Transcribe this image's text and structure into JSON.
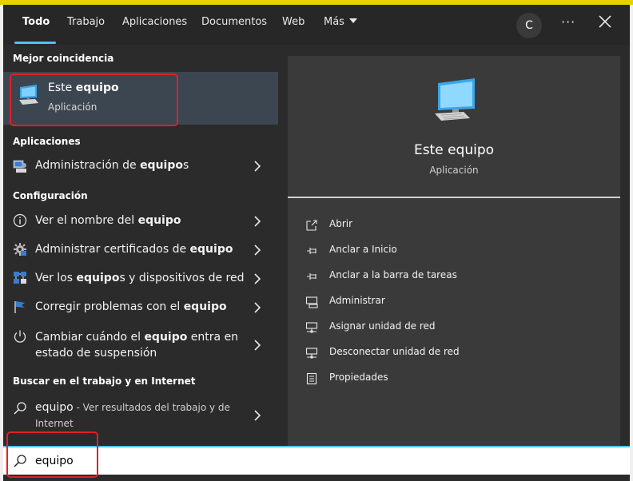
{
  "tabs": {
    "todo": "Todo",
    "trabajo": "Trabajo",
    "aplicaciones": "Aplicaciones",
    "documentos": "Documentos",
    "web": "Web",
    "mas": "Más"
  },
  "header": {
    "avatar_initial": "C",
    "more_glyph": "···"
  },
  "best_match": {
    "heading": "Mejor coincidencia",
    "title_prefix": "Este ",
    "title_bold": "equipo",
    "subtitle": "Aplicación",
    "icon": "computer-icon"
  },
  "sections": {
    "aplicaciones": "Aplicaciones",
    "configuracion": "Configuración",
    "buscar": "Buscar en el trabajo y en Internet"
  },
  "apps": [
    {
      "pre": "Administración de ",
      "bold": "equipo",
      "post": "s",
      "icon": "computer-management-icon"
    }
  ],
  "settings": [
    {
      "pre": "Ver el nombre del ",
      "bold": "equipo",
      "post": "",
      "icon": "info-icon"
    },
    {
      "pre": "Administrar certificados de ",
      "bold": "equipo",
      "post": "",
      "icon": "certificate-icon"
    },
    {
      "pre": "Ver los ",
      "bold": "equipo",
      "post": "s y dispositivos de red",
      "icon": "network-devices-icon"
    },
    {
      "pre": "Corregir problemas con el ",
      "bold": "equipo",
      "post": "",
      "icon": "flag-icon"
    },
    {
      "pre": "Cambiar cuándo el ",
      "bold": "equipo",
      "post": " entra en estado de suspensión",
      "icon": "power-icon"
    }
  ],
  "web_result": {
    "query": "equipo",
    "desc": " - Ver resultados del trabajo y de Internet"
  },
  "preview": {
    "title": "Este equipo",
    "subtitle": "Aplicación"
  },
  "actions": [
    {
      "label": "Abrir",
      "icon": "open-icon"
    },
    {
      "label": "Anclar a Inicio",
      "icon": "pin-icon"
    },
    {
      "label": "Anclar a la barra de tareas",
      "icon": "pin-taskbar-icon"
    },
    {
      "label": "Administrar",
      "icon": "manage-icon"
    },
    {
      "label": "Asignar unidad de red",
      "icon": "map-drive-icon"
    },
    {
      "label": "Desconectar unidad de red",
      "icon": "disconnect-drive-icon"
    },
    {
      "label": "Propiedades",
      "icon": "properties-icon"
    }
  ],
  "search": {
    "value": "equipo"
  },
  "colors": {
    "accent": "#4cc2ff",
    "highlight": "#e0202a",
    "selection": "#3c4650"
  }
}
